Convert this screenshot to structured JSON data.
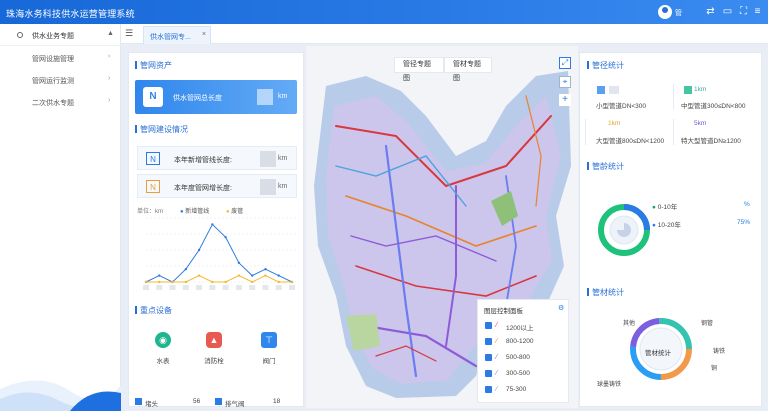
{
  "header": {
    "title": "珠海水务科技供水运营管理系统",
    "user": "管"
  },
  "sidebar": {
    "section": "供水业务专题",
    "items": [
      {
        "label": "管网设施管理"
      },
      {
        "label": "管网运行监测"
      },
      {
        "label": "二次供水专题"
      }
    ]
  },
  "tabs": [
    {
      "label": "供水管网专..."
    }
  ],
  "left": {
    "asset_title": "管网资产",
    "asset_label": "供水管网总长度",
    "asset_unit": "km",
    "build_title": "管网建设情况",
    "build_items": [
      {
        "label": "本年新增管线长度:",
        "unit": "km"
      },
      {
        "label": "本年度管网增长度:",
        "unit": "km"
      }
    ],
    "chart_unit": "单位：km",
    "legend": [
      "新增管线",
      "废管"
    ],
    "equip_title": "重点设备",
    "equipment": [
      {
        "label": "水表"
      },
      {
        "label": "消防栓"
      },
      {
        "label": "阀门"
      }
    ],
    "bottom_stats": [
      {
        "label": "堵头",
        "value": "56"
      },
      {
        "label": "排气阀",
        "value": "18"
      }
    ]
  },
  "chart_data": {
    "type": "line",
    "ylabel": "单位：km",
    "series": [
      {
        "name": "新增管线",
        "color": "#2f7de1"
      },
      {
        "name": "废管",
        "color": "#f5b82e"
      }
    ],
    "x_tick_count": 12,
    "new_pipe": [
      0,
      1,
      0,
      2,
      5,
      9,
      7,
      3,
      1,
      2,
      1,
      0
    ],
    "old_pipe": [
      0,
      0,
      0,
      0,
      1,
      0,
      0,
      1,
      0,
      1,
      0,
      0
    ]
  },
  "map": {
    "tabs": [
      "管径专题图",
      "管材专题图"
    ]
  },
  "layers": {
    "title": "图层控制面板",
    "items": [
      {
        "label": "1200以上",
        "color": "#d9363e"
      },
      {
        "label": "800-1200",
        "color": "#e8832b"
      },
      {
        "label": "500-800",
        "color": "#8e5bd8"
      },
      {
        "label": "300-500",
        "color": "#6b7cf0"
      },
      {
        "label": "75-300",
        "color": "#4aa3df"
      }
    ]
  },
  "right": {
    "diameter_title": "管径统计",
    "diameter": [
      {
        "label": "小型管道DN<300",
        "value": "",
        "color": "#5aa0f2"
      },
      {
        "label": "中型管道300≤DN<800",
        "value": "1km",
        "color": "#46c6a0"
      },
      {
        "label": "大型管道800≤DN<1200",
        "value": "1km",
        "color": "#f2b53a"
      },
      {
        "label": "特大型管道DN≥1200",
        "value": "5km",
        "color": "#8a6de0"
      }
    ],
    "age_title": "管龄统计",
    "age": [
      {
        "label": "0-10年",
        "value": "%",
        "color": "#1f9d6a"
      },
      {
        "label": "10-20年",
        "value": "75%",
        "color": "#2a7be6"
      }
    ],
    "age_chart": {
      "type": "pie",
      "series": [
        {
          "label": "0-10年",
          "value": 25,
          "color": "#2a7be6"
        },
        {
          "label": "10-20年",
          "value": 75,
          "color": "#1fc27a"
        }
      ]
    },
    "material_title": "管材统计",
    "material_center": "管材统计",
    "materials": [
      {
        "label": "钢管"
      },
      {
        "label": "铸铁"
      },
      {
        "label": "铜"
      },
      {
        "label": "球墨铸铁"
      },
      {
        "label": "其他"
      }
    ]
  }
}
